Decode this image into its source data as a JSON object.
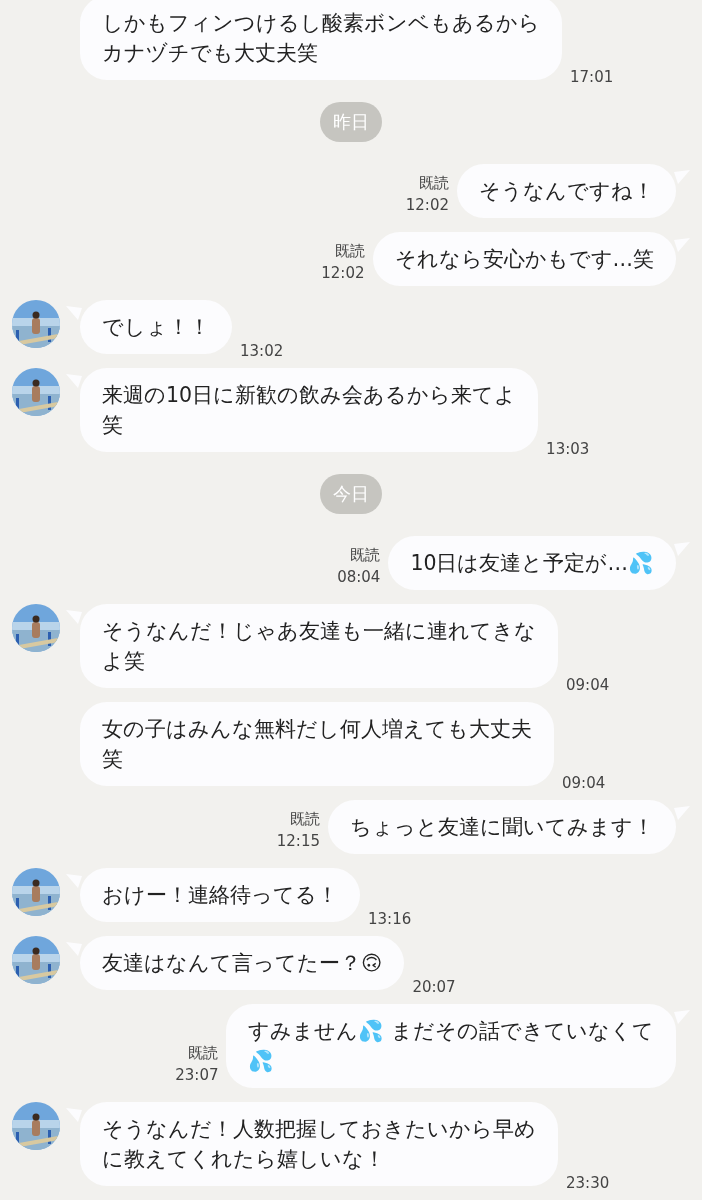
{
  "messages": [
    {
      "kind": "incoming",
      "avatar": false,
      "lines": [
        "しかもフィンつけるし酸素ボンベもあるから",
        "カナヅチでも大丈夫笑"
      ],
      "time": "17:01"
    },
    {
      "kind": "date",
      "text": "昨日"
    },
    {
      "kind": "outgoing",
      "read_label": "既読",
      "lines": [
        "そうなんですね！"
      ],
      "time": "12:02"
    },
    {
      "kind": "outgoing",
      "read_label": "既読",
      "lines": [
        "それなら安心かもです…笑"
      ],
      "time": "12:02"
    },
    {
      "kind": "incoming",
      "avatar": true,
      "lines": [
        "でしょ！！"
      ],
      "time": "13:02"
    },
    {
      "kind": "incoming",
      "avatar": true,
      "lines": [
        "来週の10日に新歓の飲み会あるから来てよ",
        "笑"
      ],
      "time": "13:03"
    },
    {
      "kind": "date",
      "text": "今日"
    },
    {
      "kind": "outgoing",
      "read_label": "既読",
      "lines": [
        "10日は友達と予定が…💦"
      ],
      "time": "08:04"
    },
    {
      "kind": "incoming",
      "avatar": true,
      "lines": [
        "そうなんだ！じゃあ友達も一緒に連れてきな",
        "よ笑"
      ],
      "time": "09:04"
    },
    {
      "kind": "incoming",
      "avatar": false,
      "lines": [
        "女の子はみんな無料だし何人増えても大丈夫",
        "笑"
      ],
      "time": "09:04"
    },
    {
      "kind": "outgoing",
      "read_label": "既読",
      "lines": [
        "ちょっと友達に聞いてみます！"
      ],
      "time": "12:15"
    },
    {
      "kind": "incoming",
      "avatar": true,
      "lines": [
        "おけー！連絡待ってる！"
      ],
      "time": "13:16"
    },
    {
      "kind": "incoming",
      "avatar": true,
      "lines": [
        "友達はなんて言ってたー？🙃"
      ],
      "time": "20:07"
    },
    {
      "kind": "outgoing",
      "read_label": "既読",
      "lines": [
        "すみません💦 まだその話できていなくて",
        "💦"
      ],
      "time": "23:07"
    },
    {
      "kind": "incoming",
      "avatar": true,
      "lines": [
        "そうなんだ！人数把握しておきたいから早め",
        "に教えてくれたら嬉しいな！"
      ],
      "time": "23:30"
    }
  ]
}
